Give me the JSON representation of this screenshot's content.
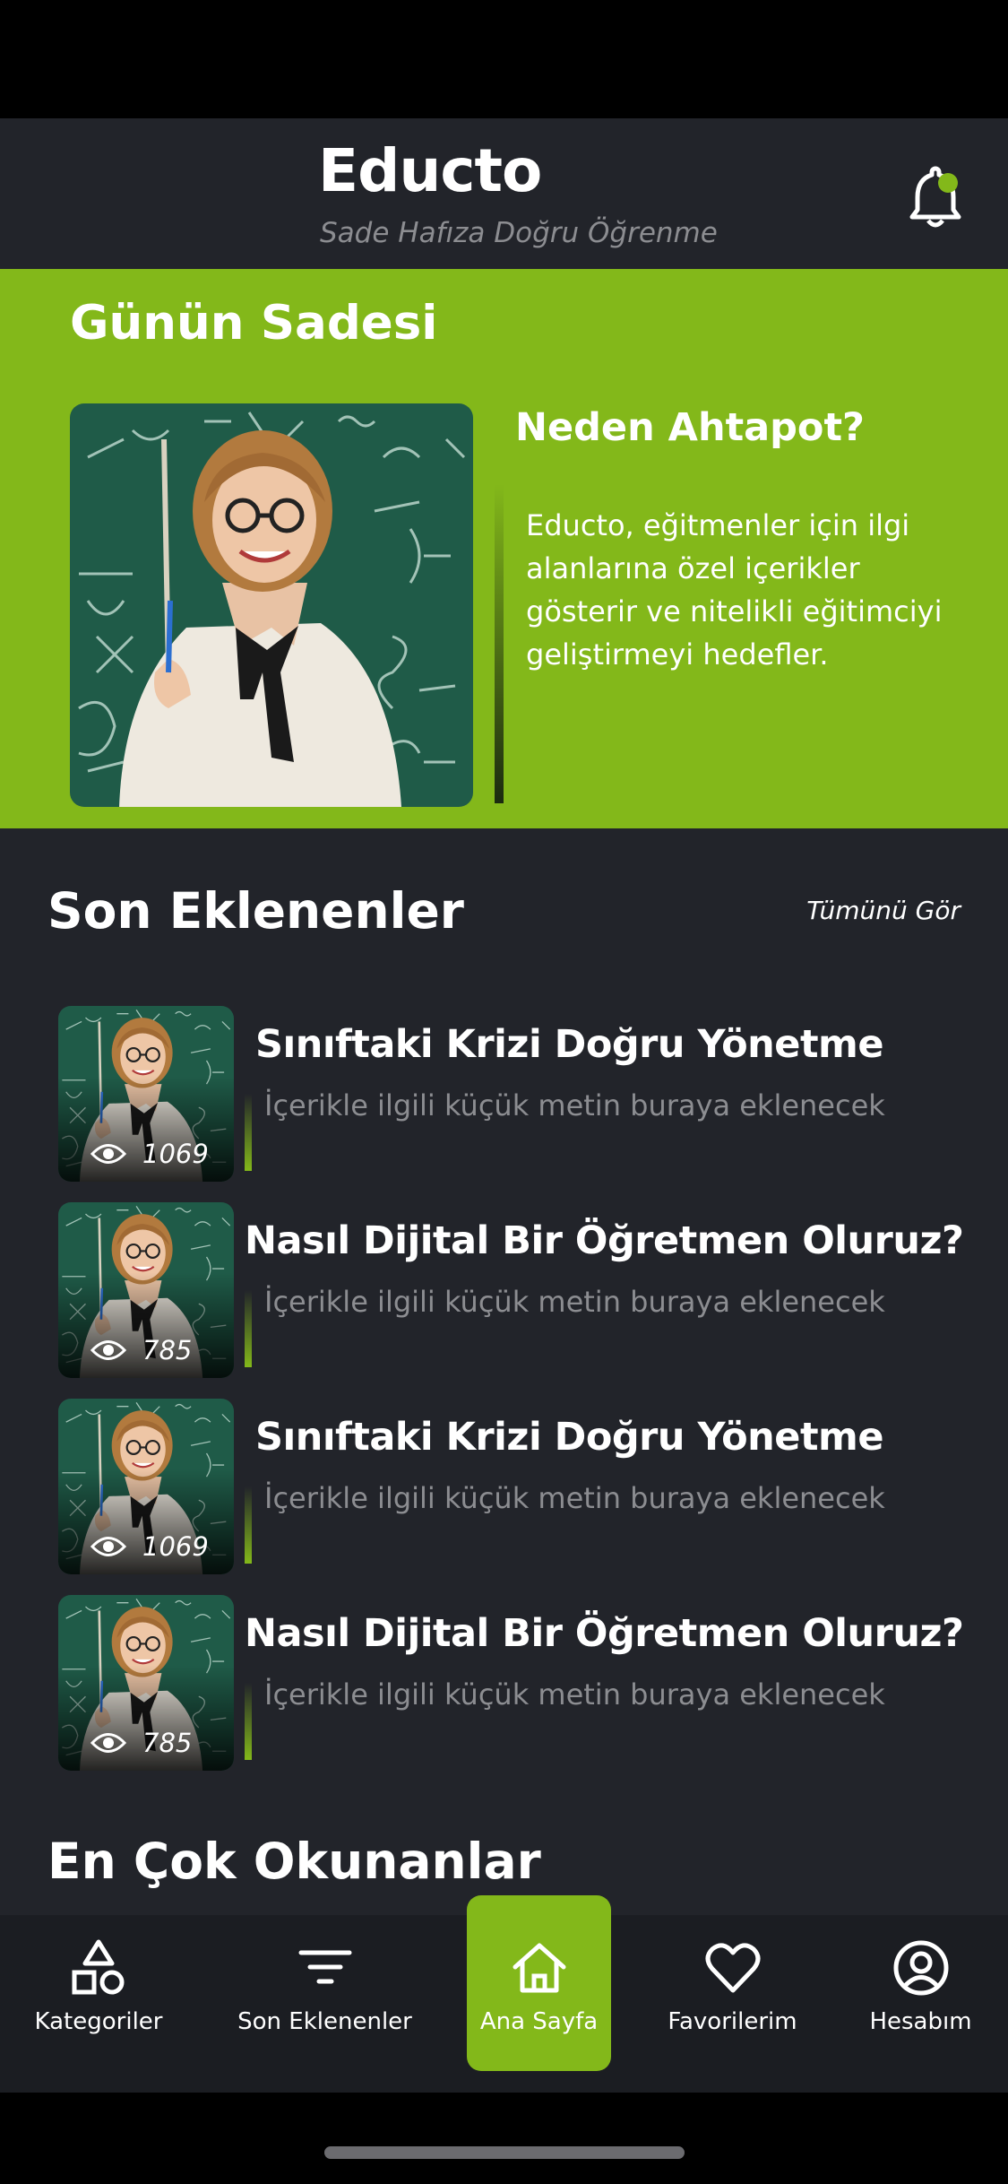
{
  "app": {
    "title": "Educto",
    "subtitle": "Sade Hafıza Doğru Öğrenme"
  },
  "colors": {
    "accent": "#83b81a",
    "background": "#22242a",
    "muted_text": "#8c8d91",
    "nav_background": "#1b1d22"
  },
  "header": {
    "notification_icon": "bell-icon"
  },
  "daily": {
    "title": "Günün Sadesi",
    "heading": "Neden Ahtapot?",
    "text": "Educto, eğitmenler için ilgi alanlarına özel içerikler gösterir ve nitelikli eğitimciyi geliştirmeyi hedefler."
  },
  "recent": {
    "title": "Son Eklenenler",
    "see_all": "Tümünü Gör",
    "items": [
      {
        "title": "Sınıftaki Krizi Doğru Yönetme",
        "description": "İçerikle ilgili küçük metin buraya eklenecek",
        "views": "1069"
      },
      {
        "title": "Nasıl Dijital Bir Öğretmen Oluruz?",
        "description": "İçerikle ilgili küçük metin buraya eklenecek",
        "views": "785"
      },
      {
        "title": "Sınıftaki Krizi Doğru Yönetme",
        "description": "İçerikle ilgili küçük metin buraya eklenecek",
        "views": "1069"
      },
      {
        "title": "Nasıl Dijital Bir Öğretmen Oluruz?",
        "description": "İçerikle ilgili küçük metin buraya eklenecek",
        "views": "785"
      }
    ]
  },
  "most_read": {
    "title": "En Çok Okunanlar"
  },
  "nav": {
    "items": [
      {
        "label": "Kategoriler",
        "icon": "shapes-icon"
      },
      {
        "label": "Son Eklenenler",
        "icon": "filter-icon"
      },
      {
        "label": "Ana Sayfa",
        "icon": "home-icon",
        "active": true
      },
      {
        "label": "Favorilerim",
        "icon": "heart-icon"
      },
      {
        "label": "Hesabım",
        "icon": "account-icon"
      }
    ]
  }
}
